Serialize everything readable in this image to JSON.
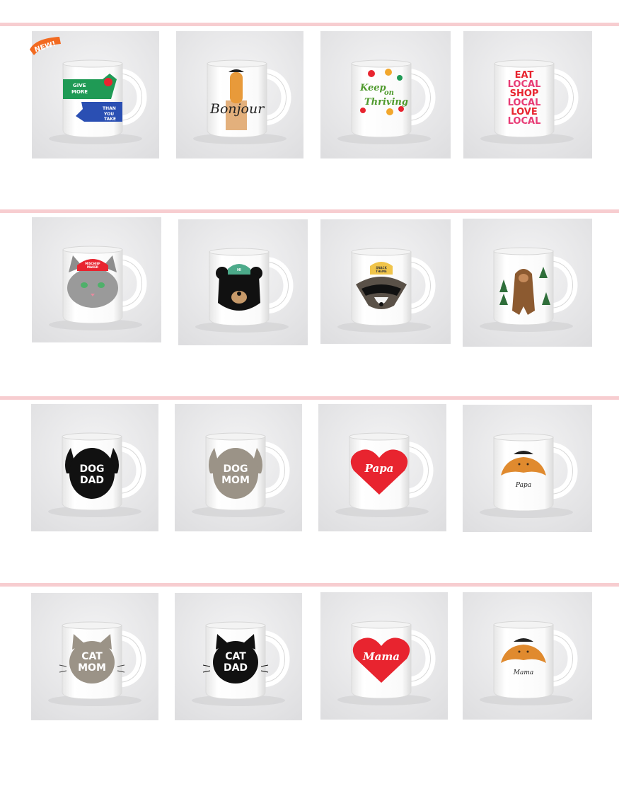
{
  "badge": {
    "new": "NEW!"
  },
  "rows": [
    {
      "products": [
        {
          "design": "give-more",
          "lines": [
            "GIVE",
            "MORE",
            "THAN",
            "YOU",
            "TAKE"
          ]
        },
        {
          "design": "bonjour",
          "lines": [
            "Bonjour"
          ]
        },
        {
          "design": "keep-on-thriving",
          "lines": [
            "Keep",
            "on",
            "Thriving"
          ]
        },
        {
          "design": "eat-local",
          "lines": [
            "EAT",
            "LOCAL",
            "SHOP",
            "LOCAL",
            "LOVE",
            "LOCAL"
          ]
        }
      ]
    },
    {
      "products": [
        {
          "design": "cat-hat",
          "lines": [
            "MISCHIEF",
            "MAKER"
          ]
        },
        {
          "design": "bear-hat",
          "lines": [
            "HI"
          ]
        },
        {
          "design": "raccoon-hat",
          "lines": [
            "SNACK",
            "THEME"
          ]
        },
        {
          "design": "bigfoot",
          "lines": []
        }
      ]
    },
    {
      "products": [
        {
          "design": "dog-dad",
          "lines": [
            "DOG",
            "DAD"
          ]
        },
        {
          "design": "dog-mom",
          "lines": [
            "DOG",
            "MOM"
          ]
        },
        {
          "design": "papa-heart",
          "lines": [
            "Papa"
          ]
        },
        {
          "design": "papa-croissant",
          "lines": [
            "Papa"
          ]
        }
      ]
    },
    {
      "products": [
        {
          "design": "cat-mom",
          "lines": [
            "CAT",
            "MOM"
          ]
        },
        {
          "design": "cat-dad",
          "lines": [
            "CAT",
            "DAD"
          ]
        },
        {
          "design": "mama-heart",
          "lines": [
            "Mama"
          ]
        },
        {
          "design": "mama-croissant",
          "lines": [
            "Mama"
          ]
        }
      ]
    }
  ],
  "colors": {
    "divider": "#f7cdd0",
    "tile_background": "#e9e9ea",
    "green": "#1f9a55",
    "blue": "#2a4fb3",
    "red": "#e8242f",
    "pink": "#e83a74",
    "warm_gray": "#9b9387",
    "black": "#111111",
    "croissant": "#e08a2e",
    "tree": "#2f6e3a"
  }
}
